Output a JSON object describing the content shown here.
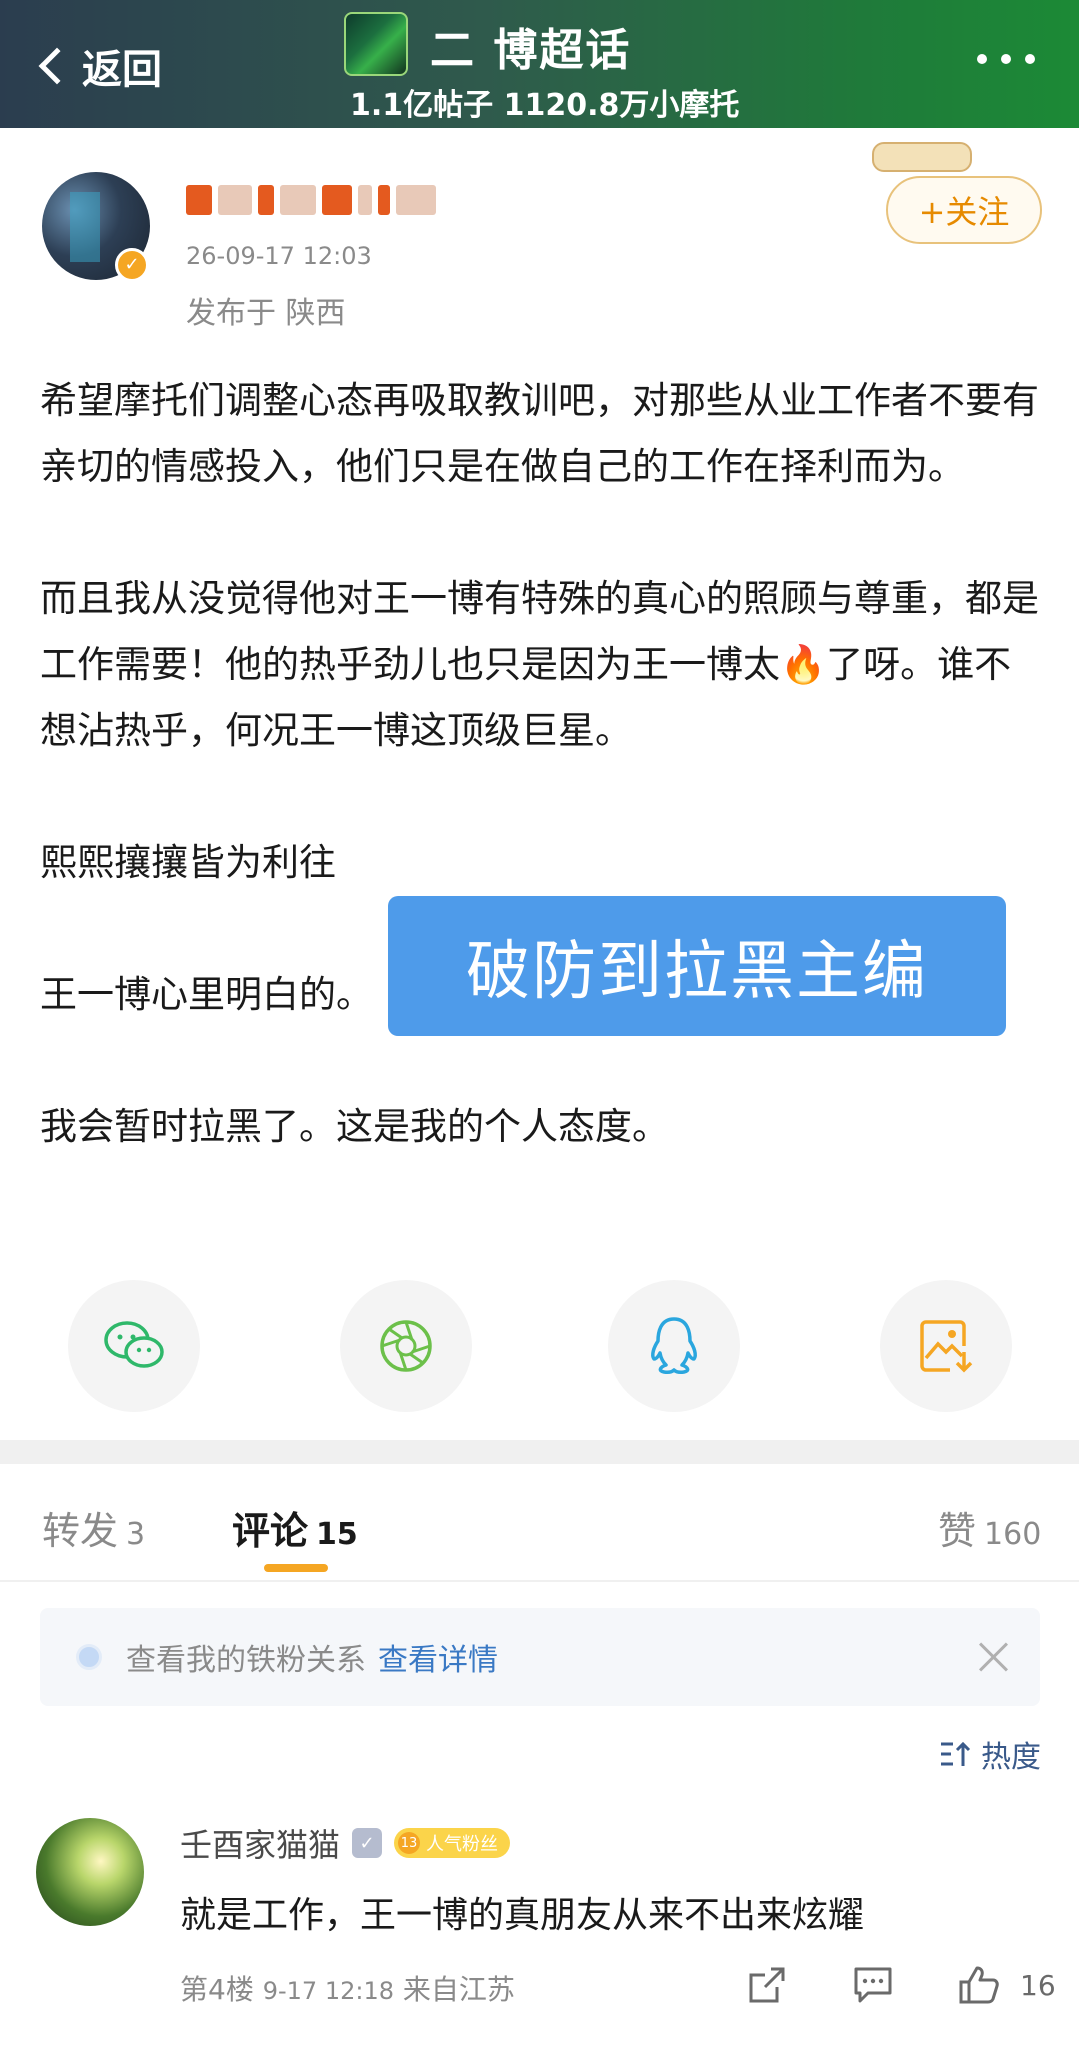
{
  "topbar": {
    "back_label": "返回",
    "topic_title": "二  博超话",
    "topic_stats": "1.1亿帖子 1120.8万小摩托"
  },
  "post": {
    "timestamp": "26-09-17 12:03",
    "location": "发布于 陕西",
    "follow_label": "+关注",
    "paragraphs": [
      "希望摩托们调整心态再吸取教训吧，对那些从业工作者不要有亲切的情感投入，他们只是在做自己的工作在择利而为。",
      "而且我从没觉得他对王一博有特殊的真心的照顾与尊重，都是工作需要！他的热乎劲儿也只是因为王一博太🔥了呀。谁不想沾热乎，何况王一博这顶级巨星。",
      "熙熙攘攘皆为利往",
      "王一博心里明白的。",
      "我会暂时拉黑了。这是我的个人态度。"
    ],
    "overlay_label": "破防到拉黑主编"
  },
  "share": {
    "icons": [
      "wechat-icon",
      "moments-icon",
      "qq-icon",
      "save-image-icon"
    ],
    "colors": {
      "wechat": "#2fb86a",
      "moments": "#6cc04a",
      "qq": "#2aa6de",
      "save": "#f5a623"
    }
  },
  "tabs": {
    "repost_label": "转发",
    "repost_count": "3",
    "comment_label": "评论",
    "comment_count": "15",
    "like_label": "赞",
    "like_count": "160"
  },
  "fan_banner": {
    "text": "查看我的铁粉关系",
    "link": "查看详情"
  },
  "sort": {
    "label": "热度"
  },
  "comment": {
    "username": "壬酉家猫猫",
    "fan_level": "13",
    "fan_badge": "人气粉丝",
    "text": "就是工作，王一博的真朋友从来不出来炫耀",
    "floor": "第4楼",
    "time": "9-17 12:18",
    "location": "来自江苏",
    "likes": "16"
  },
  "colors": {
    "accent": "#f5a623",
    "link": "#3a79c4",
    "overlay": "#4e9bea"
  }
}
